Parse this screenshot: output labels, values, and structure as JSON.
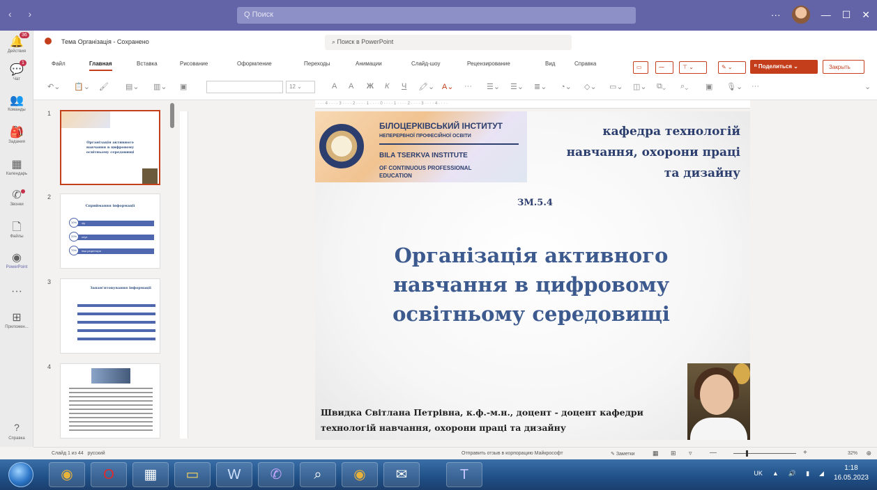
{
  "teams": {
    "search_placeholder": "Q Поиск",
    "more": "···",
    "minimize": "—",
    "maximize": "☐",
    "close": "✕",
    "rail": [
      {
        "label": "Действия",
        "badge": "36",
        "icon": "bell-icon"
      },
      {
        "label": "Чат",
        "badge": "1",
        "icon": "chat-icon"
      },
      {
        "label": "Команды",
        "icon": "teams-icon"
      },
      {
        "label": "Задания",
        "icon": "assignments-icon"
      },
      {
        "label": "Календарь",
        "icon": "calendar-icon"
      },
      {
        "label": "Звонки",
        "icon": "phone-icon"
      },
      {
        "label": "Файлы",
        "icon": "file-icon"
      },
      {
        "label": "PowerPoint",
        "icon": "powerpoint-icon"
      },
      {
        "label": "···",
        "icon": "more-icon"
      },
      {
        "label": "Приложен...",
        "icon": "apps-icon"
      }
    ],
    "help_label": "Справка"
  },
  "ppt": {
    "doc_title": "Тема Організація - Сохранено",
    "search_placeholder": "Поиск в PowerPoint",
    "tabs": [
      "Файл",
      "Главная",
      "Вставка",
      "Рисование",
      "Оформление",
      "Переходы",
      "Анимации",
      "Слайд-шоу",
      "Рецензирование",
      "Вид",
      "Справка"
    ],
    "active_tab": "Главная",
    "share_label": "Поделиться",
    "close_label": "Закрыть",
    "font_size": "12"
  },
  "thumbnails": {
    "numbers": [
      "1",
      "2",
      "3",
      "4"
    ],
    "slide2_title": "Сприймання інформації",
    "slide2_rows": [
      {
        "pct": "10%",
        "text": "зір"
      },
      {
        "pct": "20%",
        "text": "слух"
      },
      {
        "pct": "70%",
        "text": "інші рецептори"
      }
    ],
    "slide3_title": "Запам'ятовування інформації"
  },
  "slide": {
    "inst_ua": "БІЛОЦЕРКІВСЬКИЙ ІНСТИТУТ",
    "inst_ua2": "НЕПЕРЕРВНОЇ ПРОФЕСІЙНОЇ ОСВІТИ",
    "inst_en": "BILA TSERKVA INSTITUTE",
    "inst_en2": "OF CONTINUOUS PROFESSIONAL",
    "inst_en3": "EDUCATION",
    "dept_line1": "кафедра технологій",
    "dept_line2": "навчання, охорони праці",
    "dept_line3": "та дизайну",
    "code": "ЗМ.5.4",
    "title_line1": "Організація активного",
    "title_line2": "навчання в цифровому",
    "title_line3": "освітньому середовищі",
    "author_line1": "Швидка Світлана Петрівна, к.ф.-м.н., доцент - доцент кафедри",
    "author_line2": "технологій навчання, охорони праці та дизайну"
  },
  "statusbar": {
    "slide_info": "Слайд 1 из 44",
    "language": "русский",
    "feedback": "Отправить отзыв в корпорацию Майкрософт",
    "notes": "Заметки",
    "zoom": "32%"
  },
  "taskbar": {
    "lang": "UK",
    "time": "1:18",
    "date": "16.05.2023"
  },
  "colors": {
    "teams_purple": "#6264a7",
    "ppt_accent": "#c43e1c",
    "slide_title_blue": "#3d5a8f"
  }
}
